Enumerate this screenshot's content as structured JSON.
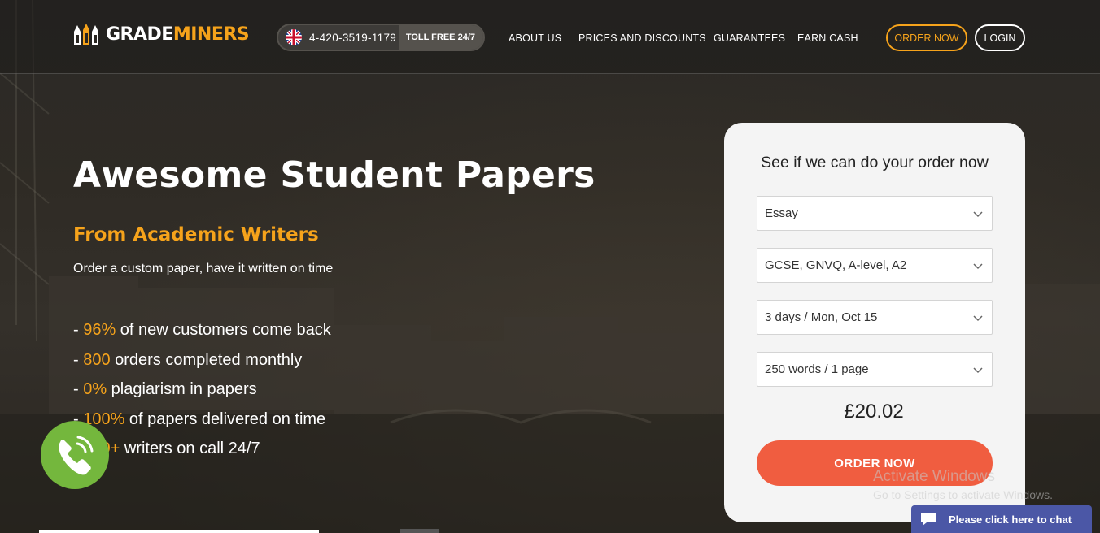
{
  "brand": {
    "logo_text_white": "GRADE",
    "logo_text_orange": "MINERS",
    "accent": "#f6a31b",
    "cta_color": "#f05d40"
  },
  "header": {
    "phone": "4-420-3519-1179",
    "toll_free": "TOLL FREE 24/7",
    "nav": [
      "ABOUT US",
      "PRICES AND DISCOUNTS",
      "GUARANTEES",
      "EARN CASH"
    ],
    "order_now": "ORDER NOW",
    "login": "LOGIN"
  },
  "hero": {
    "title": "Awesome Student Papers",
    "subtitle": "From Academic Writers",
    "description": "Order a custom paper, have it written on time",
    "stats": [
      {
        "num": "96%",
        "text": " of new customers come back"
      },
      {
        "num": "800",
        "text": " orders completed monthly"
      },
      {
        "num": "0%",
        "text": " plagiarism in papers"
      },
      {
        "num": "100%",
        "text": " of papers delivered on time"
      },
      {
        "num": "500+",
        "text": " writers on call 24/7"
      }
    ]
  },
  "order_form": {
    "title": "See if we can do your order now",
    "paper_type": "Essay",
    "level": "GCSE, GNVQ, A-level, A2",
    "deadline": "3 days / Mon, Oct 15",
    "length": "250 words / 1 page",
    "price": "£20.02",
    "submit": "ORDER NOW"
  },
  "watermark": {
    "line1": "Activate Windows",
    "line2": "Go to Settings to activate Windows."
  },
  "chat": {
    "label": "Please click here to chat"
  },
  "icons": [
    "uk-flag-icon",
    "chevron-down-icon",
    "phone-call-icon",
    "chat-bubble-icon",
    "logo-pencils-icon"
  ]
}
